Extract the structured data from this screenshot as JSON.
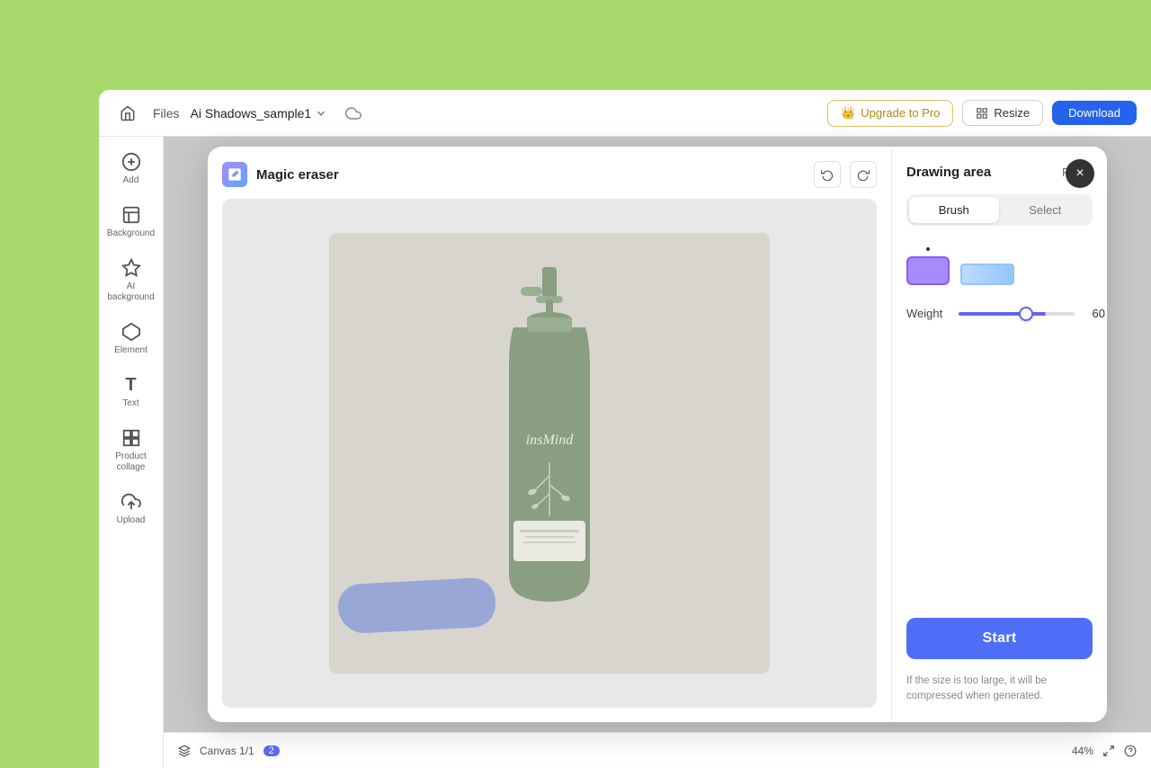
{
  "app": {
    "background_color": "#a8d96c"
  },
  "topbar": {
    "files_label": "Files",
    "project_name": "Ai Shadows_sample1",
    "upgrade_label": "Upgrade to Pro",
    "resize_label": "Resize",
    "download_label": "Download"
  },
  "sidebar": {
    "items": [
      {
        "id": "add",
        "icon": "➕",
        "label": "Add"
      },
      {
        "id": "background",
        "icon": "▦",
        "label": "Background"
      },
      {
        "id": "ai-background",
        "icon": "✦",
        "label": "AI background"
      },
      {
        "id": "element",
        "icon": "⬡",
        "label": "Element"
      },
      {
        "id": "text",
        "icon": "T",
        "label": "Text"
      },
      {
        "id": "product-collage",
        "icon": "⊞",
        "label": "Product collage"
      },
      {
        "id": "upload",
        "icon": "⬆",
        "label": "Upload"
      }
    ]
  },
  "modal": {
    "title": "Magic eraser",
    "close_label": "×",
    "drawing_area_title": "Drawing area",
    "reset_label": "Reset",
    "brush_label": "Brush",
    "select_label": "Select",
    "weight_label": "Weight",
    "weight_value": "60",
    "start_label": "Start",
    "note_text": "If the size is too large, it will be compressed when generated."
  },
  "bottombar": {
    "canvas_label": "Canvas 1/1",
    "zoom_label": "44%"
  }
}
